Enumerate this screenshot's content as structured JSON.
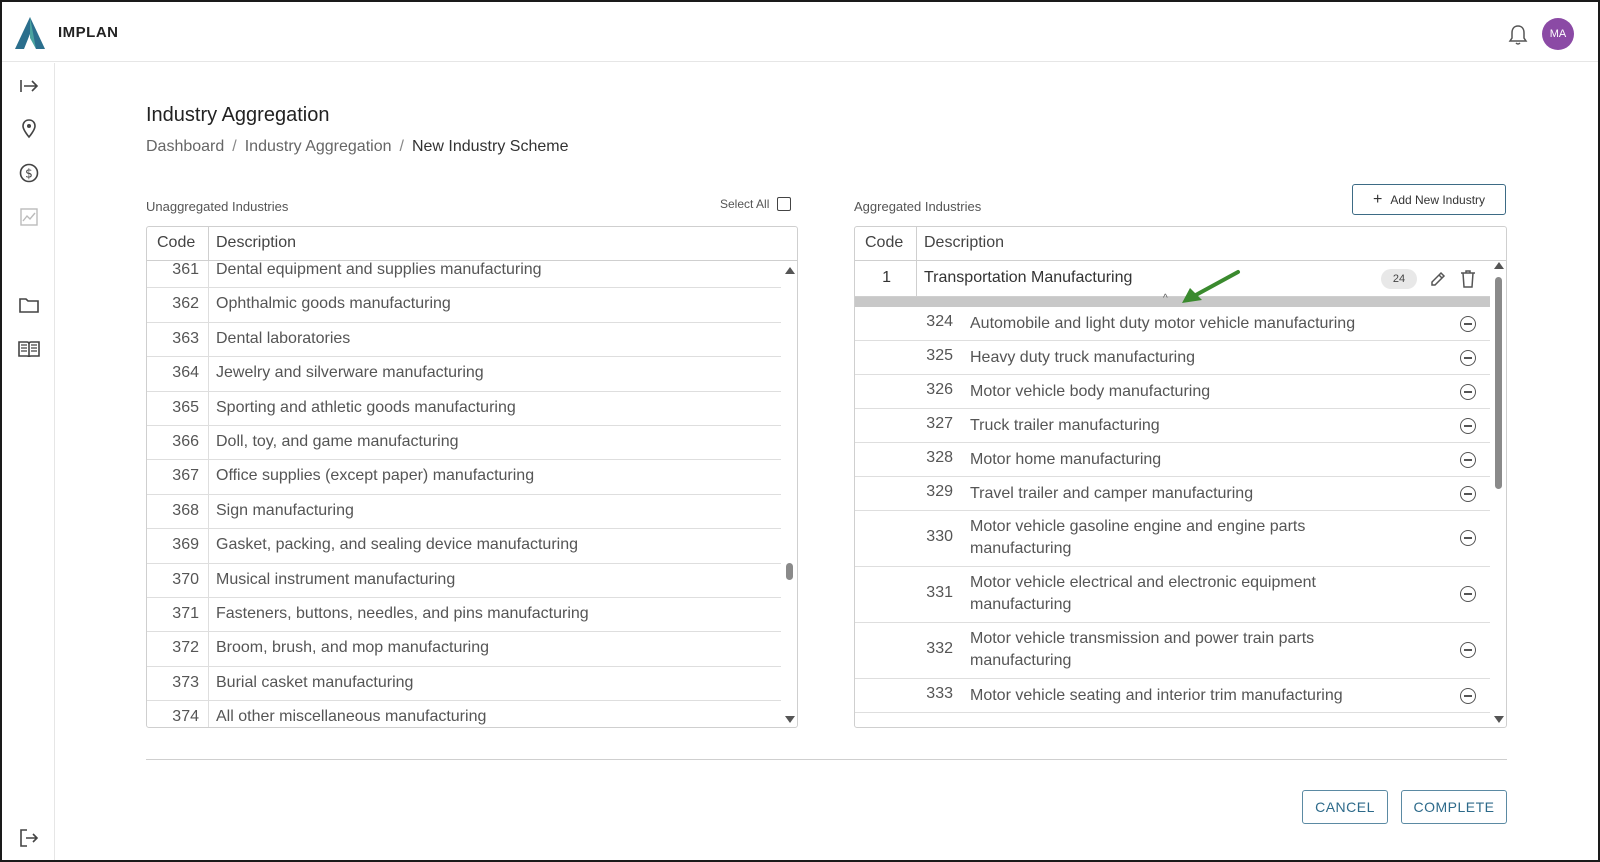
{
  "app": {
    "brand": "IMPLAN",
    "avatar_initials": "MA",
    "accent_color": "#2d6a8a",
    "avatar_color": "#8b4aa5"
  },
  "sidebar": {
    "items": [
      {
        "icon": "expand-arrow-icon"
      },
      {
        "icon": "location-pin-icon"
      },
      {
        "icon": "dollar-icon"
      },
      {
        "icon": "chart-icon"
      },
      {
        "icon": "folder-icon"
      },
      {
        "icon": "book-icon"
      },
      {
        "icon": "logout-icon"
      }
    ]
  },
  "page": {
    "title": "Industry Aggregation",
    "breadcrumb": [
      "Dashboard",
      "Industry Aggregation",
      "New Industry Scheme"
    ],
    "breadcrumb_sep": "/"
  },
  "left": {
    "label": "Unaggregated Industries",
    "select_all": "Select All",
    "col_code": "Code",
    "col_desc": "Description",
    "rows": [
      {
        "code": "361",
        "desc": "Dental equipment and supplies manufacturing"
      },
      {
        "code": "362",
        "desc": "Ophthalmic goods manufacturing"
      },
      {
        "code": "363",
        "desc": "Dental laboratories"
      },
      {
        "code": "364",
        "desc": "Jewelry and silverware manufacturing"
      },
      {
        "code": "365",
        "desc": "Sporting and athletic goods manufacturing"
      },
      {
        "code": "366",
        "desc": "Doll, toy, and game manufacturing"
      },
      {
        "code": "367",
        "desc": "Office supplies (except paper) manufacturing"
      },
      {
        "code": "368",
        "desc": "Sign manufacturing"
      },
      {
        "code": "369",
        "desc": "Gasket, packing, and sealing device manufacturing"
      },
      {
        "code": "370",
        "desc": "Musical instrument manufacturing"
      },
      {
        "code": "371",
        "desc": "Fasteners, buttons, needles, and pins manufacturing"
      },
      {
        "code": "372",
        "desc": "Broom, brush, and mop manufacturing"
      },
      {
        "code": "373",
        "desc": "Burial casket manufacturing"
      },
      {
        "code": "374",
        "desc": "All other miscellaneous manufacturing"
      }
    ]
  },
  "right": {
    "label": "Aggregated Industries",
    "add_button": "Add New Industry",
    "col_code": "Code",
    "col_desc": "Description",
    "group": {
      "code": "1",
      "name": "Transportation Manufacturing",
      "count": "24"
    },
    "rows": [
      {
        "code": "324",
        "desc": "Automobile and light duty motor vehicle manufacturing"
      },
      {
        "code": "325",
        "desc": "Heavy duty truck manufacturing"
      },
      {
        "code": "326",
        "desc": "Motor vehicle body manufacturing"
      },
      {
        "code": "327",
        "desc": "Truck trailer manufacturing"
      },
      {
        "code": "328",
        "desc": "Motor home manufacturing"
      },
      {
        "code": "329",
        "desc": "Travel trailer and camper manufacturing"
      },
      {
        "code": "330",
        "desc": "Motor vehicle gasoline engine and engine parts manufacturing"
      },
      {
        "code": "331",
        "desc": "Motor vehicle electrical and electronic equipment manufacturing"
      },
      {
        "code": "332",
        "desc": "Motor vehicle transmission and power train parts manufacturing"
      },
      {
        "code": "333",
        "desc": "Motor vehicle seating and interior trim manufacturing"
      }
    ]
  },
  "footer": {
    "cancel": "CANCEL",
    "complete": "COMPLETE"
  }
}
